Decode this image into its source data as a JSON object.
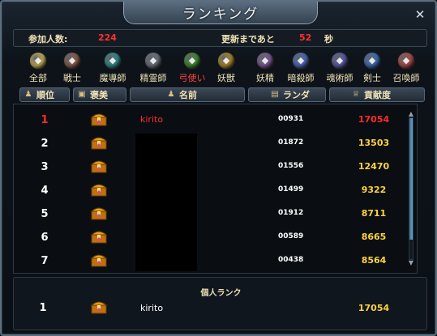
{
  "window": {
    "title": "ランキング",
    "close_icon": "close-icon"
  },
  "stats": {
    "participants_label": "参加人数:",
    "participants_value": "224",
    "update_label": "更新まであと",
    "update_value": "52",
    "update_unit": "秒"
  },
  "class_tabs": [
    {
      "label": "全部",
      "icon": "smiley-icon",
      "color": "#c9b25a",
      "active": false
    },
    {
      "label": "戦士",
      "icon": "warrior-icon",
      "color": "#8a5a4a",
      "active": false
    },
    {
      "label": "魔導師",
      "icon": "yin-yang-icon",
      "color": "#2e8d8a",
      "active": false
    },
    {
      "label": "精霊師",
      "icon": "spirit-icon",
      "color": "#6b7480",
      "active": false
    },
    {
      "label": "弓使い",
      "icon": "archer-icon",
      "color": "#3d8c2e",
      "active": true
    },
    {
      "label": "妖獣",
      "icon": "beast-icon",
      "color": "#b08a2a",
      "active": false
    },
    {
      "label": "妖精",
      "icon": "fairy-icon",
      "color": "#7c5a9a",
      "active": false
    },
    {
      "label": "暗殺師",
      "icon": "assassin-icon",
      "color": "#4a6ab8",
      "active": false
    },
    {
      "label": "魂術師",
      "icon": "soul-icon",
      "color": "#5a5aa8",
      "active": false
    },
    {
      "label": "剣士",
      "icon": "sword-icon",
      "color": "#3d6fb8",
      "active": false
    },
    {
      "label": "召喚師",
      "icon": "summoner-icon",
      "color": "#b04a4a",
      "active": false
    }
  ],
  "columns": {
    "rank": "順位",
    "reward": "褒美",
    "name": "名前",
    "random": "ランダ",
    "contribution": "貢献度"
  },
  "rows": [
    {
      "rank": "1",
      "name": "kirito",
      "code": "00931",
      "contribution": "17054",
      "highlight": true
    },
    {
      "rank": "2",
      "name": "",
      "code": "01872",
      "contribution": "13503",
      "highlight": false
    },
    {
      "rank": "3",
      "name": "",
      "code": "01556",
      "contribution": "12470",
      "highlight": false
    },
    {
      "rank": "4",
      "name": "",
      "code": "01499",
      "contribution": "9322",
      "highlight": false
    },
    {
      "rank": "5",
      "name": "",
      "code": "01912",
      "contribution": "8711",
      "highlight": false
    },
    {
      "rank": "6",
      "name": "",
      "code": "00589",
      "contribution": "8665",
      "highlight": false
    },
    {
      "rank": "7",
      "name": "",
      "code": "00438",
      "contribution": "8564",
      "highlight": false
    }
  ],
  "personal": {
    "title": "個人ランク",
    "rank": "1",
    "name": "kirito",
    "contribution": "17054"
  },
  "colors": {
    "accent_red": "#ff2a2a",
    "gold": "#ffd240",
    "label": "#f0e2b5"
  }
}
